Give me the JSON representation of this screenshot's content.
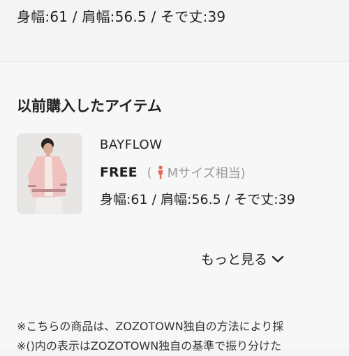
{
  "top": {
    "measurements": "身幅:61 / 肩幅:56.5 / そで丈:39"
  },
  "history": {
    "title": "以前購入したアイテム",
    "items": [
      {
        "brand": "BAYFLOW",
        "size": "FREE",
        "size_note_open": "(",
        "size_note_label": "Mサイズ相当)",
        "measurements": "身幅:61 / 肩幅:56.5 / そで丈:39",
        "icon": "person-icon",
        "icon_color": "#e0655a"
      }
    ],
    "more_label": "もっと見る",
    "more_icon": "chevron-down-icon"
  },
  "notes": [
    "※こちらの商品は、ZOZOTOWN独自の方法により採",
    "※()内の表示はZOZOTOWN独自の基準で振り分けた"
  ]
}
